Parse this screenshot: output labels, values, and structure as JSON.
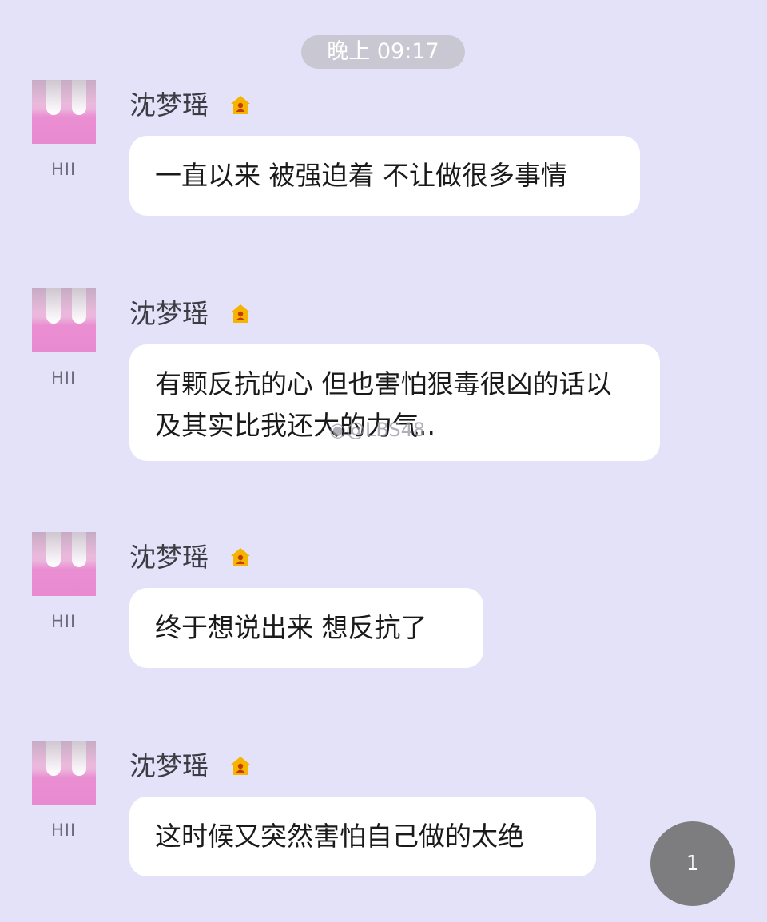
{
  "timestamp": "晚上 09:17",
  "messages": [
    {
      "sender": "沈梦瑶",
      "tag": "HII",
      "text": "一直以来 被强迫着 不让做很多事情"
    },
    {
      "sender": "沈梦瑶",
      "tag": "HII",
      "text": "有颗反抗的心 但也害怕狠毒很凶的话以及其实比我还大的力气.."
    },
    {
      "sender": "沈梦瑶",
      "tag": "HII",
      "text": "终于想说出来 想反抗了"
    },
    {
      "sender": "沈梦瑶",
      "tag": "HII",
      "text": "这时候又突然害怕自己做的太绝"
    }
  ],
  "watermark": "@LBS48",
  "unread_count": "1",
  "icons": {
    "badge": "vip-badge-icon",
    "watermark": "weibo-icon"
  },
  "colors": {
    "background": "#e3e2f8",
    "bubble": "#ffffff",
    "badge": "#f5b400",
    "fab": "#7d7d80"
  }
}
